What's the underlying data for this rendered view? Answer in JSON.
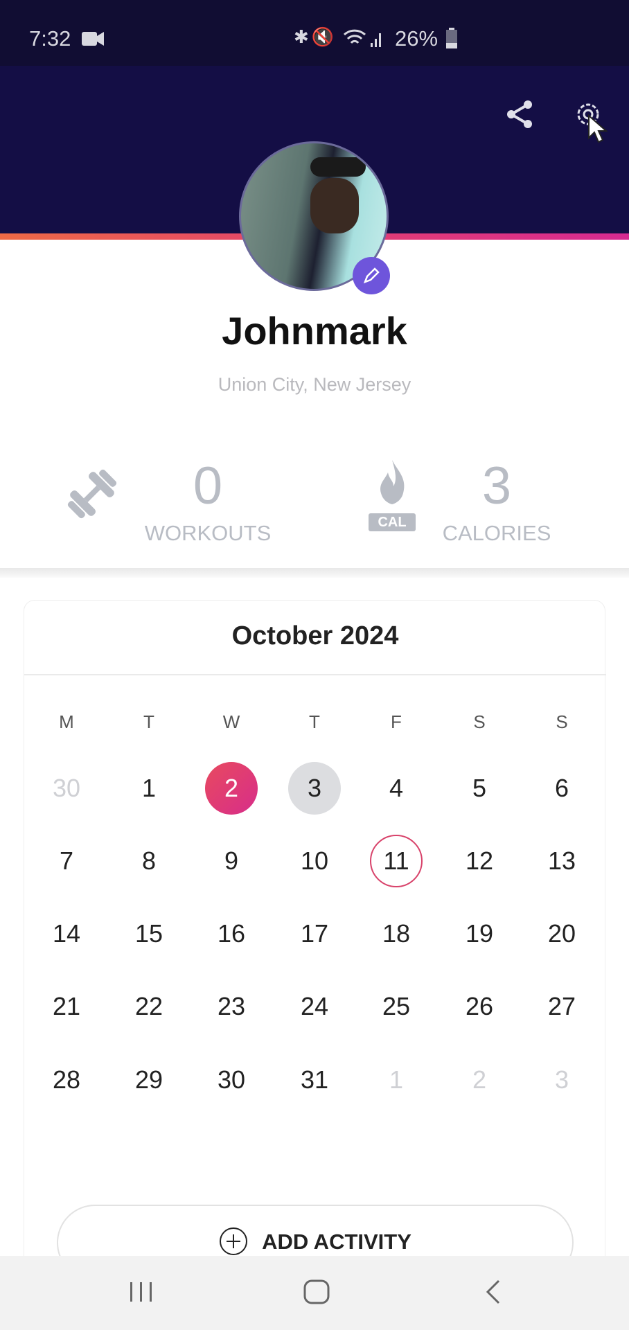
{
  "status_bar": {
    "time": "7:32",
    "battery": "26%",
    "icons": [
      "video-camera-icon",
      "bluetooth-icon",
      "mute-icon",
      "wifi-icon",
      "signal-icon",
      "battery-icon"
    ]
  },
  "header": {
    "actions": [
      "share-icon",
      "gear-icon"
    ]
  },
  "profile": {
    "name": "Johnmark",
    "location": "Union City, New Jersey"
  },
  "stats": [
    {
      "icon": "dumbbell-icon",
      "value": "0",
      "label": "WORKOUTS"
    },
    {
      "icon": "flame-cal-icon",
      "value": "3",
      "label": "CALORIES",
      "icon_text": "CAL"
    }
  ],
  "calendar": {
    "title": "October 2024",
    "weekdays": [
      "M",
      "T",
      "W",
      "T",
      "F",
      "S",
      "S"
    ],
    "weeks": [
      [
        {
          "d": "30",
          "s": "muted"
        },
        {
          "d": "1"
        },
        {
          "d": "2",
          "s": "sel"
        },
        {
          "d": "3",
          "s": "gray"
        },
        {
          "d": "4"
        },
        {
          "d": "5"
        },
        {
          "d": "6"
        }
      ],
      [
        {
          "d": "7"
        },
        {
          "d": "8"
        },
        {
          "d": "9"
        },
        {
          "d": "10"
        },
        {
          "d": "11",
          "s": "today"
        },
        {
          "d": "12"
        },
        {
          "d": "13"
        }
      ],
      [
        {
          "d": "14"
        },
        {
          "d": "15"
        },
        {
          "d": "16"
        },
        {
          "d": "17"
        },
        {
          "d": "18"
        },
        {
          "d": "19"
        },
        {
          "d": "20"
        }
      ],
      [
        {
          "d": "21"
        },
        {
          "d": "22"
        },
        {
          "d": "23"
        },
        {
          "d": "24"
        },
        {
          "d": "25"
        },
        {
          "d": "26"
        },
        {
          "d": "27"
        }
      ],
      [
        {
          "d": "28"
        },
        {
          "d": "29"
        },
        {
          "d": "30"
        },
        {
          "d": "31"
        },
        {
          "d": "1",
          "s": "muted"
        },
        {
          "d": "2",
          "s": "muted"
        },
        {
          "d": "3",
          "s": "muted"
        }
      ]
    ],
    "add_label": "ADD ACTIVITY"
  },
  "colors": {
    "header": "#140e45",
    "accent": "#6e55db",
    "selected": "#e0396f"
  }
}
